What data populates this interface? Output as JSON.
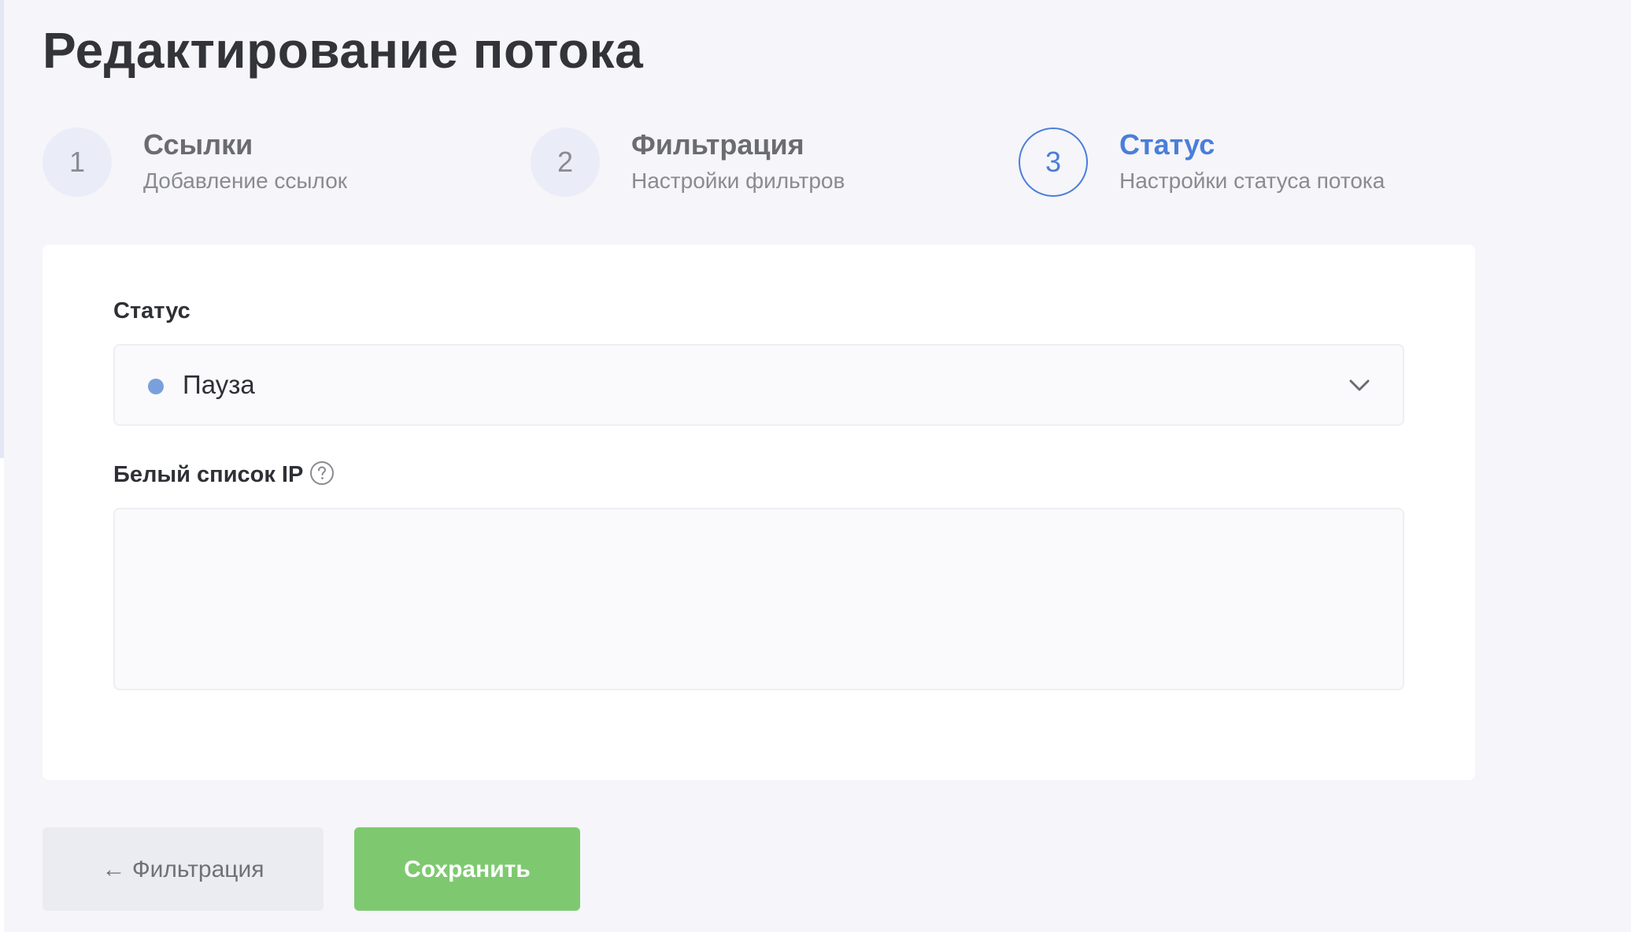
{
  "page": {
    "title": "Редактирование потока"
  },
  "steps": [
    {
      "number": "1",
      "title": "Ссылки",
      "subtitle": "Добавление ссылок",
      "active": false
    },
    {
      "number": "2",
      "title": "Фильтрация",
      "subtitle": "Настройки фильтров",
      "active": false
    },
    {
      "number": "3",
      "title": "Статус",
      "subtitle": "Настройки статуса потока",
      "active": true
    }
  ],
  "form": {
    "status_label": "Статус",
    "status_value": "Пауза",
    "status_dot_color": "#7aa0dc",
    "whitelist_label": "Белый список IP",
    "whitelist_value": ""
  },
  "buttons": {
    "back_label": "← Фильтрация",
    "save_label": "Сохранить"
  },
  "colors": {
    "accent": "#4a7ed8",
    "save": "#7ec970",
    "background": "#f5f5fa"
  }
}
